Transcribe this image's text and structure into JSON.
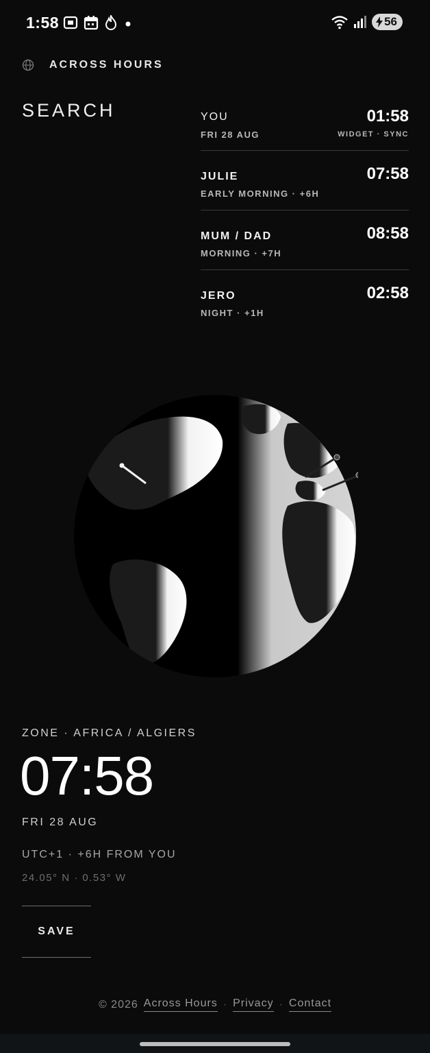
{
  "status_bar": {
    "time": "1:58",
    "battery": "56"
  },
  "header": {
    "brand": "ACROSS HOURS",
    "search": "SEARCH"
  },
  "clocks": {
    "you": {
      "name": "YOU",
      "date": "FRI 28 AUG",
      "time": "01:58",
      "meta": "WIDGET · SYNC"
    },
    "friends": [
      {
        "name": "JULIE",
        "sub": "EARLY MORNING · +6H",
        "time": "07:58"
      },
      {
        "name": "MUM / DAD",
        "sub": "MORNING · +7H",
        "time": "08:58"
      },
      {
        "name": "JERO",
        "sub": "NIGHT · +1H",
        "time": "02:58"
      }
    ]
  },
  "zone": {
    "label": "ZONE · AFRICA / ALGIERS",
    "time": "07:58",
    "date": "FRI 28 AUG",
    "offset": "UTC+1 · +6H FROM YOU",
    "coords": "24.05° N · 0.53° W",
    "save_label": "SAVE"
  },
  "footer": {
    "copyright": "© 2026",
    "brand_link": "Across Hours",
    "privacy": "Privacy",
    "contact": "Contact"
  },
  "colors": {
    "background": "#0b0b0b",
    "text": "#eeeeee",
    "muted": "#b8b8b8",
    "divider": "#3a3a3a"
  }
}
